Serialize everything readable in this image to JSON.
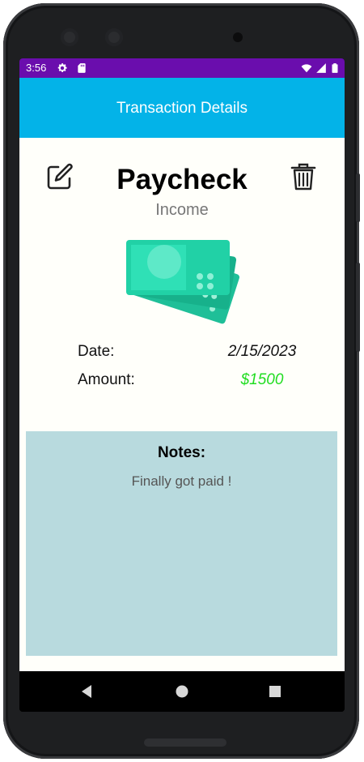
{
  "status_bar": {
    "time": "3:56",
    "bg_color": "#6a0dad",
    "left_icons": [
      "settings-icon",
      "sd-card-icon"
    ],
    "right_icons": [
      "wifi-icon",
      "signal-icon",
      "battery-icon"
    ]
  },
  "app_bar": {
    "title": "Transaction Details",
    "bg_color": "#03b3e8"
  },
  "transaction": {
    "title": "Paycheck",
    "type": "Income",
    "image": "money-bills-icon",
    "date_label": "Date:",
    "date_value": "2/15/2023",
    "amount_label": "Amount:",
    "amount_value": "$1500",
    "amount_color": "#22dd22"
  },
  "notes": {
    "heading": "Notes:",
    "text": "Finally got paid !",
    "bg_color": "#b8dade"
  },
  "actions": {
    "edit_icon": "edit-icon",
    "delete_icon": "trash-icon"
  },
  "nav_bar": {
    "buttons": [
      "back-icon",
      "home-icon",
      "recents-icon"
    ]
  }
}
